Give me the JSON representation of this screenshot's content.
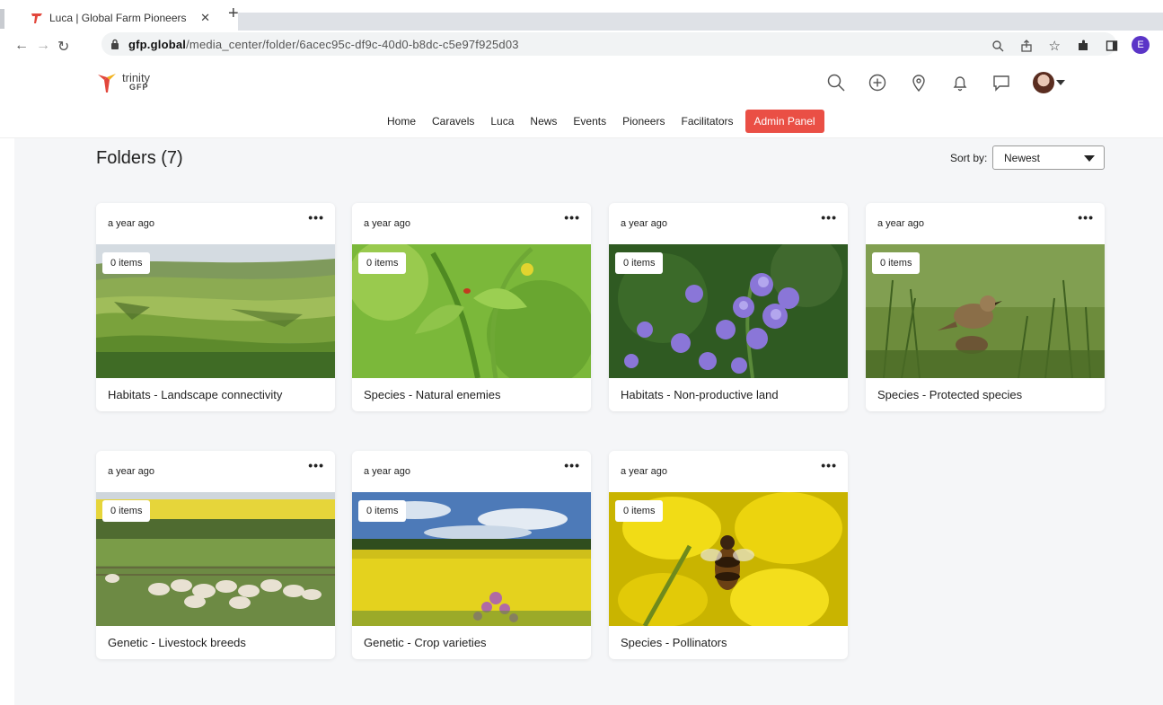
{
  "browser": {
    "tab_title": "Luca | Global Farm Pioneers",
    "tab_close": "✕",
    "new_tab": "+",
    "url_host": "gfp.global",
    "url_path": "/media_center/folder/6acec95c-df9c-40d0-b8dc-c5e97f925d03",
    "profile_initial": "E",
    "profile_color": "#5b35c7"
  },
  "header": {
    "logo_line1": "trinity",
    "logo_line2": "GFP",
    "nav": [
      "Home",
      "Caravels",
      "Luca",
      "News",
      "Events",
      "Pioneers",
      "Facilitators"
    ],
    "admin_label": "Admin Panel",
    "admin_color": "#ea4f45"
  },
  "content": {
    "title": "Folders (7)",
    "sort_label": "Sort by:",
    "sort_value": "Newest",
    "folders": [
      {
        "date": "a year ago",
        "items": "0 items",
        "title": "Habitats - Landscape connectivity",
        "image": "landscape"
      },
      {
        "date": "a year ago",
        "items": "0 items",
        "title": "Species - Natural enemies",
        "image": "grass-insect"
      },
      {
        "date": "a year ago",
        "items": "0 items",
        "title": "Habitats - Non-productive land",
        "image": "bluebells"
      },
      {
        "date": "a year ago",
        "items": "0 items",
        "title": "Species - Protected species",
        "image": "bird"
      },
      {
        "date": "a year ago",
        "items": "0 items",
        "title": "Genetic - Livestock breeds",
        "image": "sheep"
      },
      {
        "date": "a year ago",
        "items": "0 items",
        "title": "Genetic - Crop varieties",
        "image": "rapeseed-field"
      },
      {
        "date": "a year ago",
        "items": "0 items",
        "title": "Species - Pollinators",
        "image": "bee"
      }
    ],
    "menu_glyph": "•••"
  }
}
